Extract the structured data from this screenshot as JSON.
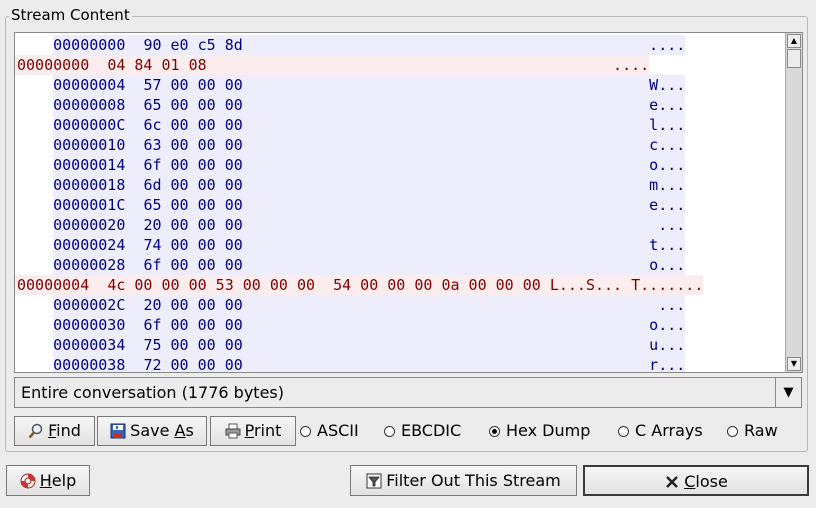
{
  "window": {
    "group_title": "Stream Content"
  },
  "dump": {
    "lines": [
      {
        "side": "client",
        "offset": "00000000",
        "hex": "90 e0 c5 8d",
        "ascii": "...."
      },
      {
        "side": "server",
        "offset": "00000000",
        "hex": "04 84 01 08",
        "ascii": "...."
      },
      {
        "side": "client",
        "offset": "00000004",
        "hex": "57 00 00 00",
        "ascii": "W..."
      },
      {
        "side": "client",
        "offset": "00000008",
        "hex": "65 00 00 00",
        "ascii": "e..."
      },
      {
        "side": "client",
        "offset": "0000000C",
        "hex": "6c 00 00 00",
        "ascii": "l..."
      },
      {
        "side": "client",
        "offset": "00000010",
        "hex": "63 00 00 00",
        "ascii": "c..."
      },
      {
        "side": "client",
        "offset": "00000014",
        "hex": "6f 00 00 00",
        "ascii": "o..."
      },
      {
        "side": "client",
        "offset": "00000018",
        "hex": "6d 00 00 00",
        "ascii": "m..."
      },
      {
        "side": "client",
        "offset": "0000001C",
        "hex": "65 00 00 00",
        "ascii": "e..."
      },
      {
        "side": "client",
        "offset": "00000020",
        "hex": "20 00 00 00",
        "ascii": " ..."
      },
      {
        "side": "client",
        "offset": "00000024",
        "hex": "74 00 00 00",
        "ascii": "t..."
      },
      {
        "side": "client",
        "offset": "00000028",
        "hex": "6f 00 00 00",
        "ascii": "o..."
      },
      {
        "side": "server",
        "offset": "00000004",
        "hex": "4c 00 00 00 53 00 00 00  54 00 00 00 0a 00 00 00",
        "ascii": "L...S... T......."
      },
      {
        "side": "client",
        "offset": "0000002C",
        "hex": "20 00 00 00",
        "ascii": " ..."
      },
      {
        "side": "client",
        "offset": "00000030",
        "hex": "6f 00 00 00",
        "ascii": "o..."
      },
      {
        "side": "client",
        "offset": "00000034",
        "hex": "75 00 00 00",
        "ascii": "u..."
      },
      {
        "side": "client",
        "offset": "00000038",
        "hex": "72 00 00 00",
        "ascii": "r..."
      }
    ],
    "colors": {
      "client_text": "#000080",
      "client_bg": "#ededfc",
      "server_text": "#800000",
      "server_bg": "#fbeded"
    }
  },
  "conversation": {
    "selected": "Entire conversation (1776 bytes)"
  },
  "buttons": {
    "find": {
      "icon": "magnifier-icon",
      "label": "Find",
      "mnemonic": "F",
      "rest": "ind"
    },
    "save_as": {
      "icon": "floppy-disk-icon",
      "label": "Save As",
      "pre": "Save ",
      "mnemonic": "A",
      "rest": "s"
    },
    "print": {
      "icon": "printer-icon",
      "label": "Print",
      "mnemonic": "P",
      "rest": "rint"
    },
    "help": {
      "icon": "lifebuoy-icon",
      "label": "Help",
      "mnemonic": "H",
      "rest": "elp"
    },
    "filter_out": {
      "icon": "funnel-icon",
      "label": "Filter Out This Stream"
    },
    "close": {
      "icon": "close-x-icon",
      "label": "Close",
      "mnemonic": "C",
      "rest": "lose"
    }
  },
  "formats": [
    {
      "label": "ASCII",
      "selected": false
    },
    {
      "label": "EBCDIC",
      "selected": false
    },
    {
      "label": "Hex Dump",
      "selected": true
    },
    {
      "label": "C Arrays",
      "selected": false
    },
    {
      "label": "Raw",
      "selected": false
    }
  ]
}
